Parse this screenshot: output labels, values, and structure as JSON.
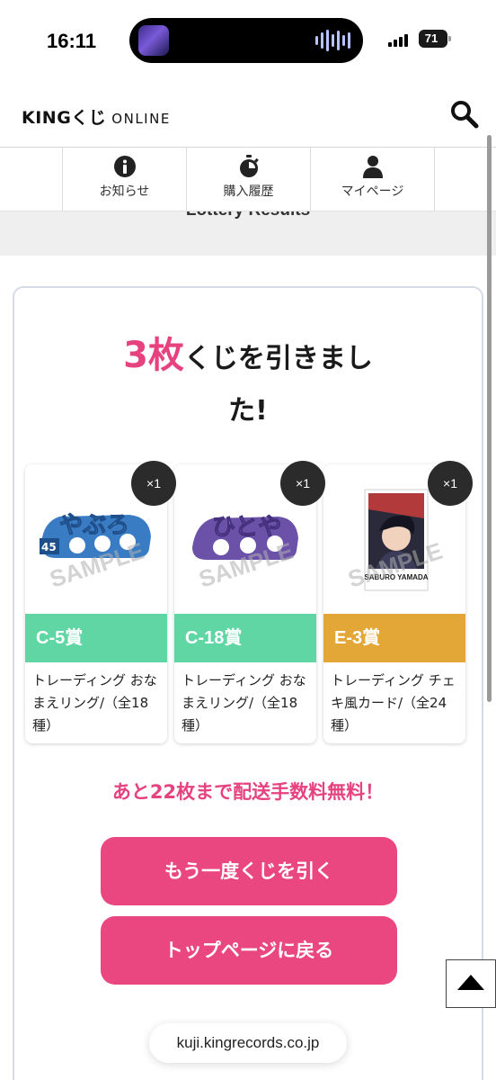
{
  "status_bar": {
    "time": "16:11",
    "battery": "71"
  },
  "header": {
    "logo_main": "KINGくじ",
    "logo_sub": "ONLINE"
  },
  "nav": [
    {
      "label": "お知らせ",
      "icon": "info-icon"
    },
    {
      "label": "購入履歴",
      "icon": "stopwatch-icon"
    },
    {
      "label": "マイページ",
      "icon": "user-icon"
    }
  ],
  "section": {
    "title": "Lottery Results"
  },
  "result": {
    "count": "3枚",
    "line1_rest": "くじを引きまし",
    "line2": "た!"
  },
  "prizes": [
    {
      "qty": "×1",
      "rank": "C-5賞",
      "name": "トレーディング おなまえリング/（全18種）",
      "rank_color": "#5fd6a3",
      "image": "name-ring-blue"
    },
    {
      "qty": "×1",
      "rank": "C-18賞",
      "name": "トレーディング おなまえリング/（全18種）",
      "rank_color": "#5fd6a3",
      "image": "name-ring-purple"
    },
    {
      "qty": "×1",
      "rank": "E-3賞",
      "name": "トレーディング チェキ風カード/（全24種）",
      "rank_color": "#e3a737",
      "image": "cheki-card"
    }
  ],
  "image_text": {
    "sample": "SAMPLE",
    "ring1": "やぶろ",
    "ring1_num": "45",
    "ring2": "ひとや",
    "card_name": "SABURO YAMADA"
  },
  "shipping_note": "あと22枚まで配送手数料無料！",
  "buttons": {
    "draw_again": "もう一度くじを引く",
    "back_top": "トップページに戻る"
  },
  "browser": {
    "url": "kuji.kingrecords.co.jp"
  }
}
